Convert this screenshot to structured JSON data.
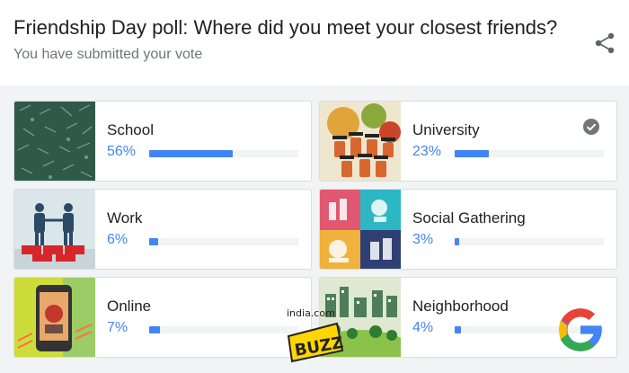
{
  "poll": {
    "title": "Friendship Day poll: Where did you meet your closest friends?",
    "subtitle": "You have submitted your vote",
    "share_icon": "share-icon"
  },
  "options": [
    {
      "label": "School",
      "percent_text": "56%",
      "percent": 56,
      "selected": false,
      "thumb": "chalkboard-image"
    },
    {
      "label": "University",
      "percent_text": "23%",
      "percent": 23,
      "selected": true,
      "thumb": "graduates-image"
    },
    {
      "label": "Work",
      "percent_text": "6%",
      "percent": 6,
      "selected": false,
      "thumb": "handshake-image"
    },
    {
      "label": "Social Gathering",
      "percent_text": "3%",
      "percent": 3,
      "selected": false,
      "thumb": "party-collage-image"
    },
    {
      "label": "Online",
      "percent_text": "7%",
      "percent": 7,
      "selected": false,
      "thumb": "phone-image"
    },
    {
      "label": "Neighborhood",
      "percent_text": "4%",
      "percent": 4,
      "selected": false,
      "thumb": "houses-image"
    }
  ],
  "colors": {
    "accent": "#4285f4",
    "track": "#f1f3f4",
    "check": "#70757a"
  },
  "watermark": {
    "brand_top": "india.com",
    "brand_main": "BUZZ"
  }
}
